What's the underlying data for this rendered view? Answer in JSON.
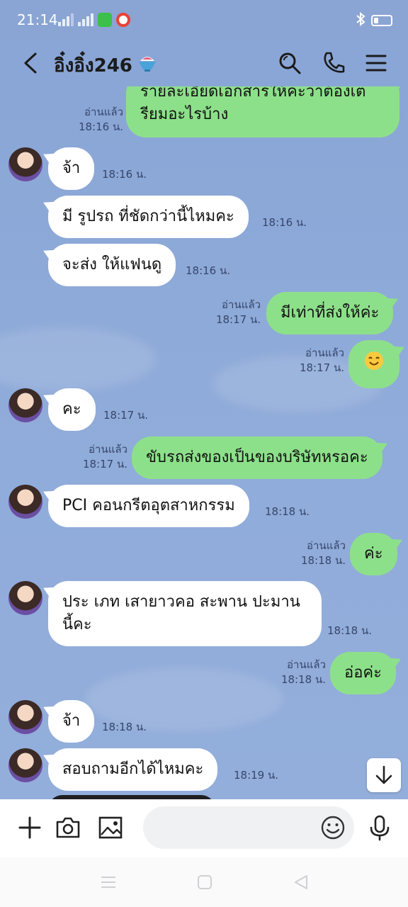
{
  "status_bar": {
    "time": "21:14"
  },
  "header": {
    "title": "อิ๋งอิ๋ง246"
  },
  "messages": [
    {
      "side": "out",
      "text_line1": "รายละเอียดเอกสารให้คะว่าต้องเต",
      "text_line2": "รียมอะไรบ้าง",
      "read": "อ่านแล้ว",
      "time": "18:16 น."
    },
    {
      "side": "in",
      "text": "จ้า",
      "time": "18:16 น."
    },
    {
      "side": "in",
      "text": "มี รูปรถ ที่ชัดกว่านี้ไหมคะ",
      "time": "18:16 น."
    },
    {
      "side": "in",
      "text": "จะส่ง ให้แฟนดู",
      "time": "18:16 น."
    },
    {
      "side": "out",
      "text": "มีเท่าที่ส่งให้ค่ะ",
      "read": "อ่านแล้ว",
      "time": "18:17 น."
    },
    {
      "side": "out",
      "text": "😊",
      "read": "อ่านแล้ว",
      "time": "18:17 น."
    },
    {
      "side": "in",
      "text": "คะ",
      "time": "18:17 น."
    },
    {
      "side": "out",
      "text": "ขับรถส่งของเป็นของบริษัทหรอคะ",
      "read": "อ่านแล้ว",
      "time": "18:17 น."
    },
    {
      "side": "in",
      "text": "PCI คอนกรีตอุตสาหกรรม",
      "time": "18:18 น."
    },
    {
      "side": "out",
      "text": "ค่ะ",
      "read": "อ่านแล้ว",
      "time": "18:18 น."
    },
    {
      "side": "in",
      "text_line1": "ประ เภท เสายาวคอ สะพาน ปะมาน",
      "text_line2": "นี้คะ",
      "time": "18:18 น."
    },
    {
      "side": "out",
      "text": "อ่อค่ะ",
      "read": "อ่านแล้ว",
      "time": "18:18 น."
    },
    {
      "side": "in",
      "text": "จ้า",
      "time": "18:18 น."
    },
    {
      "side": "in",
      "text": "สอบถามอีกได้ไหมคะ",
      "time": "18:19 น."
    }
  ],
  "input": {
    "placeholder": ""
  },
  "colors": {
    "background": "#8aa6d6",
    "outgoing_bubble": "#8de08a",
    "incoming_bubble": "#ffffff"
  }
}
